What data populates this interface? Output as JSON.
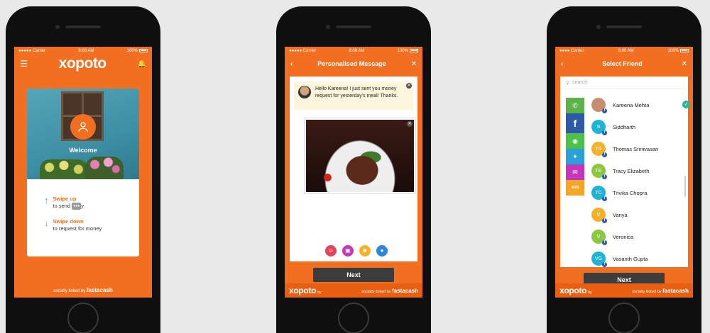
{
  "status": {
    "carrier": "●●●●● Carrier",
    "carrier3": "●●●● Carrier",
    "time": "8:08 AM",
    "battery": "100%"
  },
  "screen1": {
    "logo": "xopoto",
    "welcome": "Welcome",
    "swipe_up_head": "Swipe up",
    "swipe_up_sub": "to send",
    "swipe_up_tail": "y",
    "swipe_down_head": "Swipe down",
    "swipe_down_sub": "to request for money",
    "footer_prefix": "socially linked by",
    "footer_brand": "fastacash"
  },
  "screen2": {
    "title": "Personalised Message",
    "message": "Hello Kareena! I just sent you money request for yesterday's meal! Thanks.",
    "next": "Next"
  },
  "screen3": {
    "title": "Select Friend",
    "search_placeholder": "search",
    "next": "Next",
    "channels": [
      "",
      "f",
      "",
      "",
      "",
      "SMS"
    ],
    "friends": [
      {
        "name": "Kareena Mehta",
        "initials": "",
        "color": "#c98d6e",
        "selected": true
      },
      {
        "name": "Siddharth",
        "initials": "S",
        "color": "#1fb3d6"
      },
      {
        "name": "Thomas Srinivasan",
        "initials": "TS",
        "color": "#f6b12b"
      },
      {
        "name": "Tracy Elizabeth",
        "initials": "TE",
        "color": "#8dc63f"
      },
      {
        "name": "Trivika Chopra",
        "initials": "TC",
        "color": "#1fb3d6"
      },
      {
        "name": "Vanya",
        "initials": "V",
        "color": "#f6b12b"
      },
      {
        "name": "Veronica",
        "initials": "V",
        "color": "#8dc63f"
      },
      {
        "name": "Vasanth Gupta",
        "initials": "VG",
        "color": "#1fb3d6"
      }
    ]
  },
  "footer2": {
    "logo": "xopoto",
    "by": "by",
    "linked_prefix": "socially linked by",
    "linked_brand": "fastacash"
  },
  "colors": {
    "accent": "#f26f21",
    "dark": "#3c3c3c"
  }
}
